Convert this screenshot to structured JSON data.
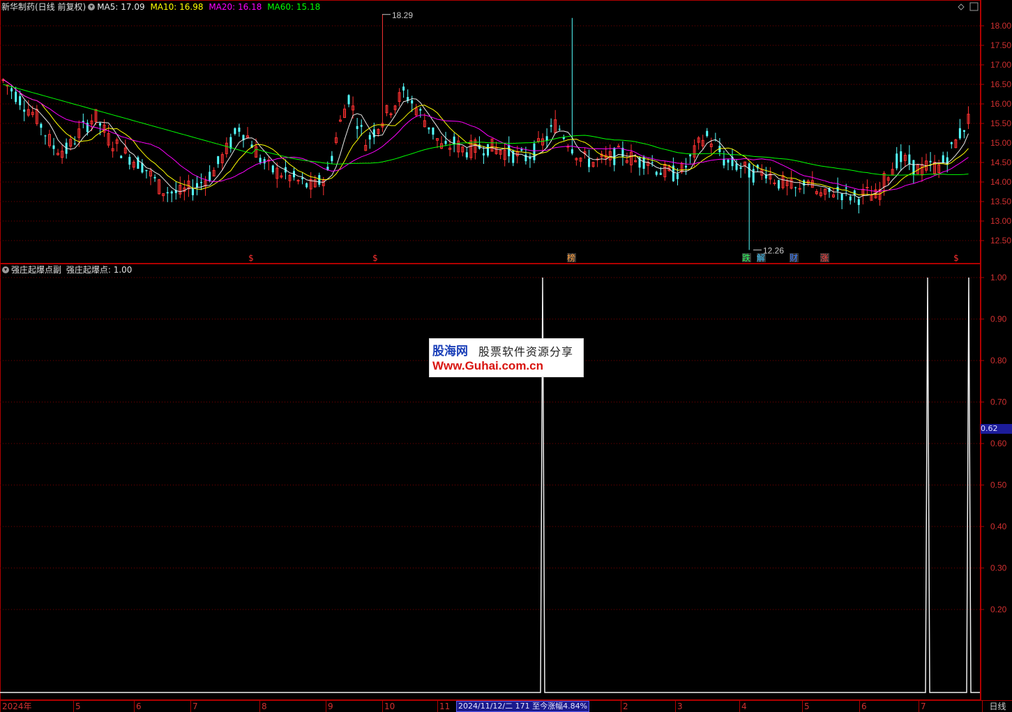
{
  "header": {
    "stock": "新华制药(日线 前复权)",
    "ma5_label": "MA5: 17.09",
    "ma10_label": "MA10: 16.98",
    "ma20_label": "MA20: 16.18",
    "ma60_label": "MA60: 15.18",
    "colors": {
      "ma5": "#e8e8e8",
      "ma10": "#ffff00",
      "ma20": "#ff00ff",
      "ma60": "#00ff00"
    }
  },
  "indicator_header": {
    "name": "强庄起爆点副",
    "value_label": "强庄起爆点: 1.00"
  },
  "status": {
    "info": "2024/11/12/二 171 至今涨幅4.84%",
    "current_value": "0.62",
    "period_button": "日线"
  },
  "watermark": {
    "brand": "股海网",
    "slogan": "股票软件资源分享",
    "url": "Www.Guhai.com.cn"
  },
  "chart_data": [
    {
      "type": "candlestick",
      "y_ticks": [
        "18.00",
        "17.50",
        "17.00",
        "16.50",
        "16.00",
        "15.50",
        "15.00",
        "14.50",
        "14.00",
        "13.50",
        "13.00",
        "12.50"
      ],
      "ylim": [
        12.2,
        18.4
      ],
      "annotations": [
        {
          "text": "18.29",
          "value": 18.29
        },
        {
          "text": "12.26",
          "value": 12.26
        }
      ],
      "event_markers": [
        {
          "label": "$",
          "color": "#ff3030"
        },
        {
          "label": "$",
          "color": "#ff3030"
        },
        {
          "label": "榜",
          "color": "#ffa040"
        },
        {
          "label": "跌",
          "color": "#30ff60"
        },
        {
          "label": "解",
          "color": "#40c8ff"
        },
        {
          "label": "财",
          "color": "#4080ff"
        },
        {
          "label": "涨",
          "color": "#ff4040"
        },
        {
          "label": "$",
          "color": "#ff3030"
        }
      ],
      "ma_series": [
        "MA5",
        "MA10",
        "MA20",
        "MA60"
      ],
      "price_path": [
        [
          0,
          16.6
        ],
        [
          10,
          16.1
        ],
        [
          20,
          15.6
        ],
        [
          28,
          14.9
        ],
        [
          36,
          14.8
        ],
        [
          44,
          15.3
        ],
        [
          52,
          15.7
        ],
        [
          60,
          15.1
        ],
        [
          70,
          14.7
        ],
        [
          80,
          14.4
        ],
        [
          90,
          13.8
        ],
        [
          100,
          13.7
        ],
        [
          110,
          13.9
        ],
        [
          120,
          14.3
        ],
        [
          128,
          14.9
        ],
        [
          134,
          15.4
        ],
        [
          140,
          15.1
        ],
        [
          146,
          14.6
        ],
        [
          152,
          14.3
        ],
        [
          160,
          14.2
        ],
        [
          168,
          14.0
        ],
        [
          176,
          13.85
        ],
        [
          184,
          14.2
        ],
        [
          190,
          15.3
        ],
        [
          196,
          16.2
        ],
        [
          200,
          15.7
        ],
        [
          206,
          15.0
        ],
        [
          212,
          15.4
        ],
        [
          220,
          15.9
        ],
        [
          228,
          16.3
        ],
        [
          236,
          15.8
        ],
        [
          244,
          15.3
        ],
        [
          250,
          14.8
        ],
        [
          256,
          15.0
        ],
        [
          262,
          14.8
        ],
        [
          270,
          14.9
        ],
        [
          276,
          14.9
        ],
        [
          284,
          14.8
        ],
        [
          290,
          14.7
        ],
        [
          296,
          14.6
        ],
        [
          302,
          14.8
        ],
        [
          308,
          15.1
        ],
        [
          314,
          15.5
        ],
        [
          320,
          15.1
        ],
        [
          328,
          14.6
        ],
        [
          336,
          14.5
        ],
        [
          344,
          14.6
        ],
        [
          352,
          14.75
        ],
        [
          360,
          14.5
        ],
        [
          366,
          14.6
        ],
        [
          372,
          14.3
        ],
        [
          380,
          14.2
        ],
        [
          386,
          14.3
        ],
        [
          392,
          14.7
        ],
        [
          398,
          15.2
        ],
        [
          404,
          15.0
        ],
        [
          410,
          14.5
        ],
        [
          418,
          14.4
        ],
        [
          426,
          14.2
        ],
        [
          433,
          14.3
        ],
        [
          440,
          14.0
        ],
        [
          446,
          13.9
        ],
        [
          452,
          13.7
        ],
        [
          456,
          14.2
        ],
        [
          460,
          13.8
        ],
        [
          466,
          13.6
        ],
        [
          472,
          13.8
        ],
        [
          478,
          13.7
        ],
        [
          484,
          13.6
        ],
        [
          490,
          13.7
        ],
        [
          496,
          13.6
        ],
        [
          502,
          14.2
        ],
        [
          508,
          14.6
        ],
        [
          514,
          14.5
        ],
        [
          520,
          14.3
        ],
        [
          526,
          14.4
        ],
        [
          532,
          14.4
        ],
        [
          538,
          14.8
        ],
        [
          544,
          15.3
        ],
        [
          548,
          15.6
        ]
      ]
    },
    {
      "type": "line",
      "name": "强庄起爆点",
      "y_ticks": [
        "1.00",
        "0.90",
        "0.80",
        "0.70",
        "0.60",
        "0.50",
        "0.40",
        "0.30",
        "0.20"
      ],
      "ylim": [
        0,
        1.0
      ],
      "spikes": [
        {
          "bar": 117,
          "value": 1.0
        },
        {
          "bar": 200,
          "value": 1.0
        },
        {
          "bar": 209,
          "value": 1.0
        }
      ],
      "baseline": 0
    }
  ],
  "x_axis": {
    "labels": [
      "2024年",
      "5",
      "6",
      "7",
      "8",
      "9",
      "10",
      "11",
      "2",
      "3",
      "4",
      "5",
      "6",
      "7"
    ]
  }
}
